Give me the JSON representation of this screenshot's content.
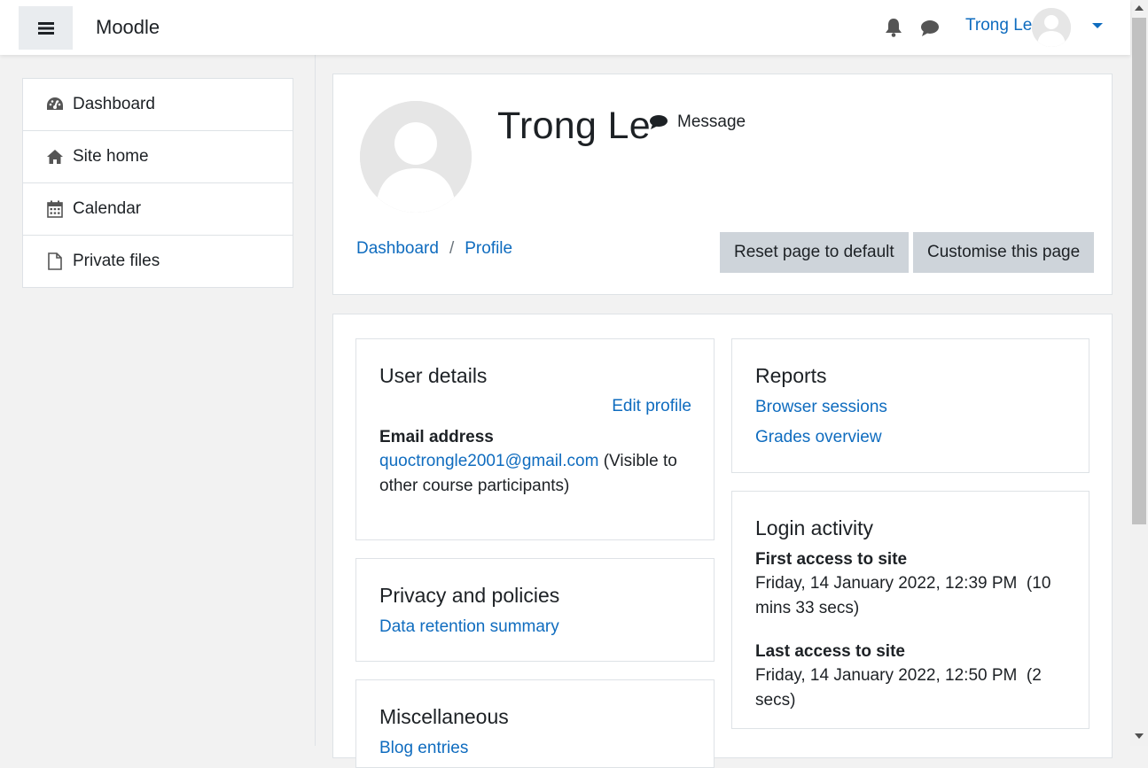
{
  "navbar": {
    "brand": "Moodle",
    "user_name": "Trong Le",
    "icons": [
      "menu-icon",
      "bell-icon",
      "chat-icon",
      "chevron-down-icon"
    ]
  },
  "drawer": {
    "items": [
      {
        "label": "Dashboard",
        "icon": "dashboard-icon"
      },
      {
        "label": "Site home",
        "icon": "home-icon"
      },
      {
        "label": "Calendar",
        "icon": "calendar-icon"
      },
      {
        "label": "Private files",
        "icon": "file-icon"
      }
    ]
  },
  "header": {
    "fullname": "Trong Le",
    "message_label": "Message",
    "breadcrumb": [
      "Dashboard",
      "Profile"
    ],
    "breadcrumb_sep": "/",
    "reset_button": "Reset page to default",
    "customise_button": "Customise this page"
  },
  "user_details": {
    "title": "User details",
    "edit_profile": "Edit profile",
    "email_label": "Email address",
    "email_value": "quoctrongle2001@gmail.com",
    "email_visibility": "(Visible to other course participants)"
  },
  "privacy": {
    "title": "Privacy and policies",
    "link": "Data retention summary"
  },
  "misc": {
    "title": "Miscellaneous",
    "link": "Blog entries"
  },
  "reports": {
    "title": "Reports",
    "links": [
      "Browser sessions",
      "Grades overview"
    ]
  },
  "login_activity": {
    "title": "Login activity",
    "first_label": "First access to site",
    "first_value": "Friday, 14 January 2022, 12:39 PM  (10 mins 33 secs)",
    "last_label": "Last access to site",
    "last_value": "Friday, 14 January 2022, 12:50 PM  (2 secs)"
  },
  "colors": {
    "link": "#0f6cbf",
    "button_bg": "#ced4da",
    "page_bg": "#f2f2f2"
  }
}
